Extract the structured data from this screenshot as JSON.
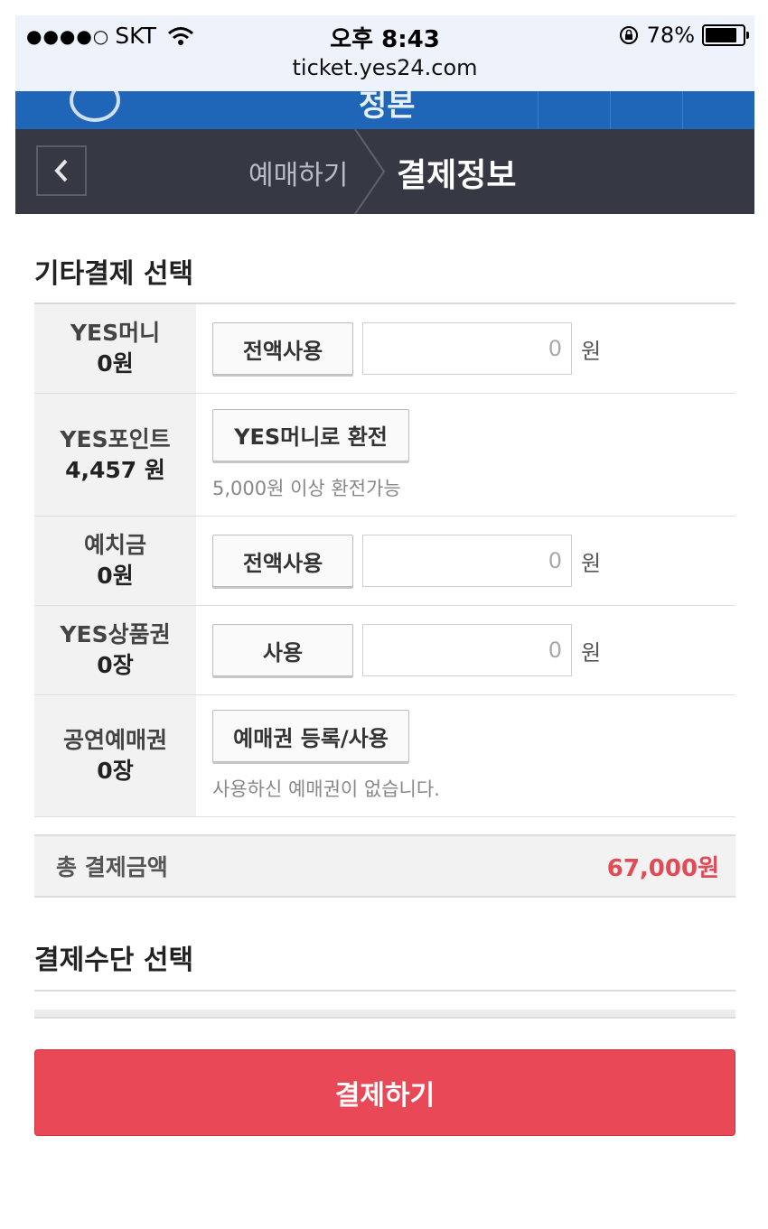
{
  "status_bar": {
    "carrier": "SKT",
    "signal_dots": "●●●●○",
    "time": "오후 8:43",
    "battery": "78%",
    "url": "ticket.yes24.com"
  },
  "header": {
    "title_peek": "정본"
  },
  "nav": {
    "prev_step": "예매하기",
    "current_step": "결제정보"
  },
  "other_payment": {
    "section_title": "기타결제 선택",
    "rows": [
      {
        "label": "YES머니",
        "amount": "0원",
        "button": "전액사용",
        "input_value": "0",
        "unit": "원"
      },
      {
        "label": "YES포인트",
        "amount": "4,457 원",
        "button": "YES머니로 환전",
        "help": "5,000원 이상 환전가능"
      },
      {
        "label": "예치금",
        "amount": "0원",
        "button": "전액사용",
        "input_value": "0",
        "unit": "원"
      },
      {
        "label": "YES상품권",
        "amount": "0장",
        "button": "사용",
        "input_value": "0",
        "unit": "원"
      },
      {
        "label": "공연예매권",
        "amount": "0장",
        "button": "예매권 등록/사용",
        "help": "사용하신 예매권이 없습니다."
      }
    ]
  },
  "total": {
    "label": "총 결제금액",
    "value": "67,000원"
  },
  "payment_method": {
    "section_title": "결제수단 선택"
  },
  "pay_button": "결제하기",
  "colors": {
    "accent_red": "#e94857",
    "nav_dark": "#363943",
    "header_blue": "#1f66b8"
  }
}
